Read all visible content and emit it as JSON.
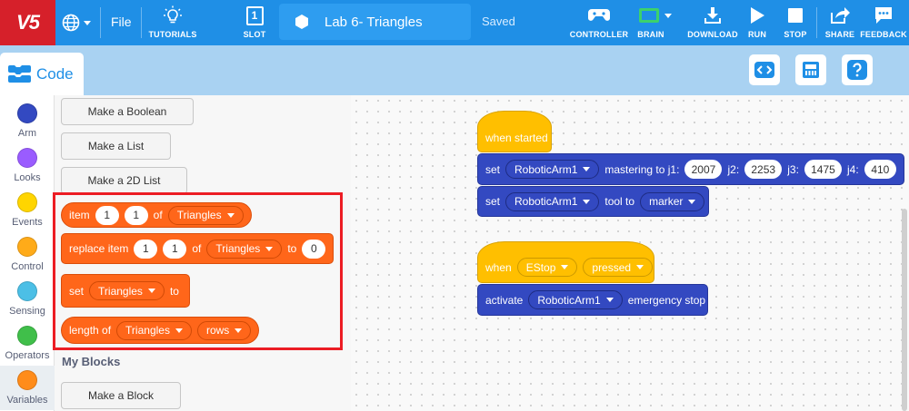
{
  "topbar": {
    "logo": "V5",
    "file": "File",
    "tutorials": "TUTORIALS",
    "slot": "SLOT",
    "slot_number": "1",
    "project_name": "Lab 6- Triangles",
    "status": "Saved",
    "controller": "CONTROLLER",
    "brain": "BRAIN",
    "download": "DOWNLOAD",
    "run": "RUN",
    "stop": "STOP",
    "share": "SHARE",
    "feedback": "FEEDBACK",
    "accent_color": "#1f8fe6",
    "logo_color": "#d6202a"
  },
  "code_tab": {
    "label": "Code"
  },
  "categories": [
    {
      "label": "Arm",
      "color": "#3349c1"
    },
    {
      "label": "Looks",
      "color": "#9a5cff"
    },
    {
      "label": "Events",
      "color": "#ffd500"
    },
    {
      "label": "Control",
      "color": "#ffab19"
    },
    {
      "label": "Sensing",
      "color": "#4cbfe6"
    },
    {
      "label": "Operators",
      "color": "#40bf4a"
    },
    {
      "label": "Variables",
      "color": "#ff8c1a"
    }
  ],
  "palette": {
    "make_boolean": "Make a Boolean",
    "make_list": "Make a List",
    "make_2d_list": "Make a 2D List",
    "item_block": {
      "label": "item",
      "row": "1",
      "col": "1",
      "of": "of",
      "list": "Triangles"
    },
    "replace_block": {
      "label": "replace item",
      "row": "1",
      "col": "1",
      "of": "of",
      "list": "Triangles",
      "to": "to",
      "value": "0"
    },
    "set_block": {
      "label": "set",
      "list": "Triangles",
      "to": "to"
    },
    "length_block": {
      "label": "length of",
      "list": "Triangles",
      "dim": "rows"
    },
    "my_blocks": "My Blocks",
    "make_block": "Make a Block"
  },
  "script1": {
    "hat": "when started",
    "set1": {
      "label": "set",
      "device": "RoboticArm1",
      "mastering": "mastering to j1:",
      "j1": "2007",
      "j2_label": "j2:",
      "j2": "2253",
      "j3_label": "j3:",
      "j3": "1475",
      "j4_label": "j4:",
      "j4": "410"
    },
    "set2": {
      "label": "set",
      "device": "RoboticArm1",
      "tool": "tool to",
      "tool_value": "marker"
    }
  },
  "script2": {
    "hat": {
      "label": "when",
      "button": "EStop",
      "event": "pressed"
    },
    "activate": {
      "label": "activate",
      "device": "RoboticArm1",
      "suffix": "emergency stop"
    }
  },
  "colors": {
    "block_orange": "#ff661a",
    "block_yellow": "#ffbf00",
    "block_blue": "#3349c1",
    "highlight_red": "#ec1c24"
  }
}
